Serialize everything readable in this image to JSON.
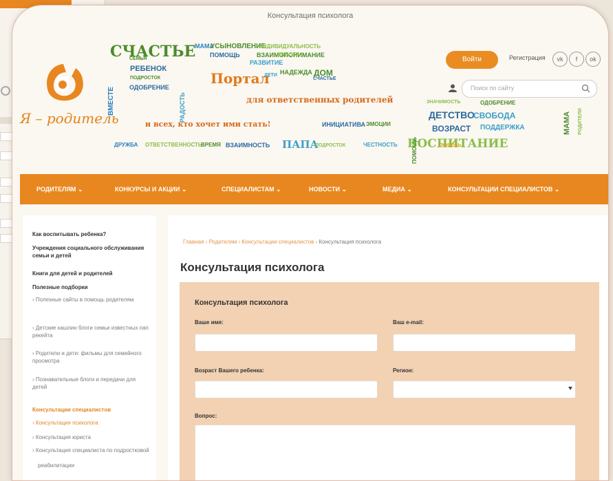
{
  "window": {
    "title": "Консультация психолога"
  },
  "logo": {
    "text": "Я – родитель"
  },
  "header": {
    "cloud_words": [
      {
        "text": "СЧАСТЬЕ",
        "color": "#4a8c2a"
      },
      {
        "text": "МАМА",
        "color": "#2a7fc0"
      },
      {
        "text": "УСЫНОВЛЕНИЕ",
        "color": "#4a8c2a"
      },
      {
        "text": "ИНДИВИДУАЛЬНОСТЬ",
        "color": "#8abf4a"
      },
      {
        "text": "ВЗАИМОПОНИМАНИЕ",
        "color": "#4a8c2a"
      },
      {
        "text": "ПОМОЩЬ",
        "color": "#2a6aa0"
      },
      {
        "text": "РАЗВИТИЕ",
        "color": "#3aa0c8"
      },
      {
        "text": "ЗАБОТА",
        "color": "#8abf4a"
      },
      {
        "text": "ВМЕСТЕ",
        "color": "#2a7fc0"
      },
      {
        "text": "СЕМЬЯ",
        "color": "#4a8c2a"
      },
      {
        "text": "РЕБЕНОК",
        "color": "#2a6aa0"
      },
      {
        "text": "ПОДРОСТОК",
        "color": "#4a8c2a"
      },
      {
        "text": "РАДОСТЬ",
        "color": "#3aa0c8"
      },
      {
        "text": "ОДОБРЕНИЕ",
        "color": "#2a6aa0"
      },
      {
        "text": "Портал",
        "color": "#e07a1a"
      },
      {
        "text": "ДЕТИ",
        "color": "#3aa0c8"
      },
      {
        "text": "НАДЕЖДА",
        "color": "#4a8c2a"
      },
      {
        "text": "ДОМ",
        "color": "#4a8c2a"
      },
      {
        "text": "СЧАСТЬЕ",
        "color": "#2a6aa0"
      },
      {
        "text": "для ответственных родителей",
        "color": "#d46b1a"
      },
      {
        "text": "и всех, кто хочет ими стать!",
        "color": "#d46b1a"
      },
      {
        "text": "ИНИЦИАТИВА",
        "color": "#2a6aa0"
      },
      {
        "text": "ЭМОЦИИ",
        "color": "#4a8c2a"
      },
      {
        "text": "ДРУЖБА",
        "color": "#2a7fc0"
      },
      {
        "text": "ОТВЕТСТВЕННОСТЬ",
        "color": "#8abf4a"
      },
      {
        "text": "ВРЕМЯ",
        "color": "#4a8c2a"
      },
      {
        "text": "ВЗАИМНОСТЬ",
        "color": "#2a6aa0"
      },
      {
        "text": "ПАПА",
        "color": "#3aa0c8"
      },
      {
        "text": "ПОДРОСТОК",
        "color": "#8abf4a"
      },
      {
        "text": "ЧЕСТНОСТЬ",
        "color": "#3aa0c8"
      },
      {
        "text": "ВОСПИТАНИЕ",
        "color": "#8abf4a"
      },
      {
        "text": "ЛЮБОВЬ",
        "color": "#e0a21a"
      },
      {
        "text": "ЗНАЧИМОСТЬ",
        "color": "#8abf4a"
      },
      {
        "text": "ОДОБРЕНИЕ",
        "color": "#4a8c2a"
      },
      {
        "text": "ДЕТСТВО",
        "color": "#2a6aa0"
      },
      {
        "text": "СВОБОДА",
        "color": "#3aa0c8"
      },
      {
        "text": "ВОЗРАСТ",
        "color": "#2a6aa0"
      },
      {
        "text": "ПОДДЕРЖКА",
        "color": "#3aa0c8"
      },
      {
        "text": "МАМА",
        "color": "#4a8c2a"
      },
      {
        "text": "РОДИТЕЛИ",
        "color": "#8abf4a"
      },
      {
        "text": "ПОМОЩЬ",
        "color": "#4a8c2a"
      }
    ],
    "login_label": "Войти",
    "register_label": "Регистрация",
    "social": [
      "vk",
      "f",
      "ok"
    ],
    "search_placeholder": "Поиск по сайту"
  },
  "nav": [
    "РОДИТЕЛЯМ",
    "КОНКУРСЫ И АКЦИИ",
    "СПЕЦИАЛИСТАМ",
    "НОВОСТИ",
    "МЕДИА",
    "КОНСУЛЬТАЦИИ СПЕЦИАЛИСТОВ"
  ],
  "sidebar": {
    "links": [
      "Как воспитывать ребенка?",
      "Учреждения социального обслуживания семьи и детей",
      "Книги для детей и родителей",
      "Полезные подборки"
    ],
    "sublinks": [
      "Полезные сайты в помощь родителям",
      "Детские кашлин блоги семьи известных пап рекейта",
      "Родители и дети: фильмы для семейного просмотра",
      "Познавательные блоги и передачи для детей"
    ],
    "section_head": "Консультации специалистов",
    "section_items": [
      "Консультация психолога",
      "Консультация юриста",
      "Консультация специалиста по подростковой",
      "реабилитации"
    ]
  },
  "breadcrumb": {
    "items": [
      "Главная",
      "Родителям",
      "Консультации специалистов"
    ],
    "current": "Консультация психолога"
  },
  "page": {
    "title": "Консультация психолога"
  },
  "form": {
    "title": "Консультация психолога",
    "name_label": "Ваше имя:",
    "email_label": "Ваш e-mail:",
    "child_age_label": "Возраст Вашего ребенка:",
    "region_label": "Регион:",
    "question_label": "Вопрос:"
  }
}
